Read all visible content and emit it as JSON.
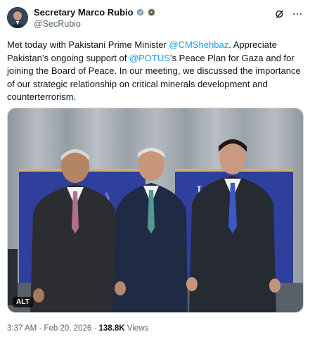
{
  "author": {
    "display_name": "Secretary Marco Rubio",
    "handle": "@SecRubio",
    "verified_color": "#829aab"
  },
  "tweet": {
    "t1": "Met today with Pakistani Prime Minister ",
    "m1": "@CMShehbaz",
    "t2": ". Appreciate Pakistan’s ongoing support of ",
    "m2": "@POTUS",
    "t3": "’s Peace Plan for Gaza and for joining the Board of Peace. In our meeting, we discussed the importance of our strategic relationship on critical minerals development and counterterrorism."
  },
  "media": {
    "alt_label": "ALT"
  },
  "meta": {
    "time": "3:37 AM",
    "sep1": "·",
    "date": "Feb 20, 2026",
    "sep2": "·",
    "views_count": "138.8K",
    "views_label": "Views"
  },
  "colors": {
    "link": "#1d9bf0",
    "text": "#0f1419",
    "secondary": "#536471"
  },
  "icons": {
    "verified": "verified-badge-icon",
    "seal": "government-seal-icon",
    "grok": "grok-icon",
    "more": "more-icon"
  }
}
